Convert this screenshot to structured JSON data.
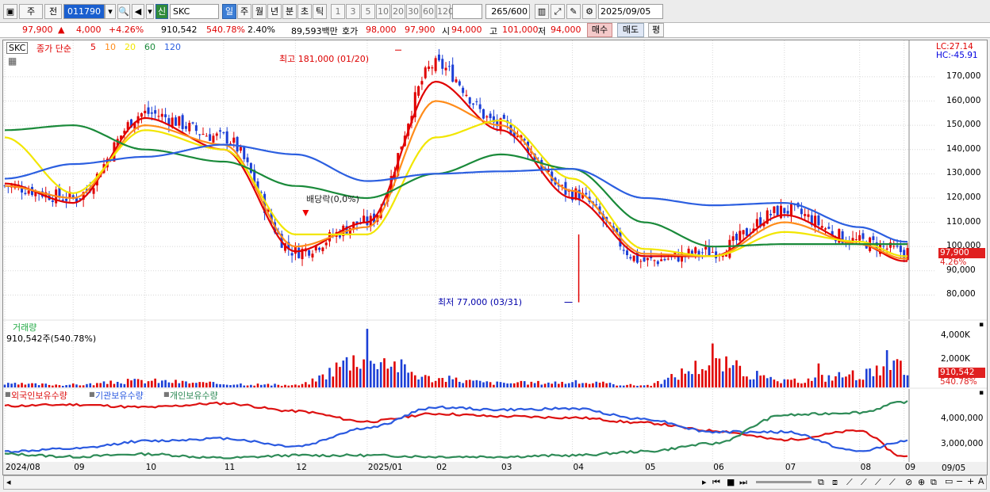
{
  "toolbar": {
    "mode_button": "주",
    "prev_button": "전",
    "code_value": "011790",
    "name_value": "SKC",
    "new_badge": "신",
    "periods": [
      "일",
      "주",
      "월",
      "년",
      "분",
      "초",
      "틱"
    ],
    "minutes": [
      "1",
      "3",
      "5",
      "10",
      "20",
      "30",
      "60",
      "120"
    ],
    "count_value": "265",
    "count_max": "/600",
    "date_value": "2025/09/05"
  },
  "quote": {
    "price": "97,900",
    "arrow": "▲",
    "change": "4,000",
    "rate": "+4.26%",
    "volume": "910,542",
    "vol_rate": "540.78%",
    "turnover": "2.40%",
    "amount": "89,593백만",
    "quote_label": "호가",
    "quote_price": "98,000",
    "quote_price2": "97,900",
    "open_label": "시",
    "open": "94,000",
    "high_label": "고",
    "high": "101,000",
    "low_label": "저",
    "low": "94,000",
    "buy_button": "매수",
    "sell_button": "매도",
    "avg_button": "평"
  },
  "legend": {
    "stock": "SKC",
    "title": "종가 단순",
    "ma": [
      {
        "label": "5",
        "color": "#e00000"
      },
      {
        "label": "10",
        "color": "#ff8c1a"
      },
      {
        "label": "20",
        "color": "#f2e600"
      },
      {
        "label": "60",
        "color": "#1a8a3a"
      },
      {
        "label": "120",
        "color": "#2c5fe0"
      }
    ]
  },
  "annotations": {
    "high_label": "최고 181,000 (01/20)",
    "low_label": "최저 77,000 (03/31)",
    "dividend_label": "배당락(0,0%)"
  },
  "price_axis": {
    "lc": "LC:27.14",
    "hc": "HC:-45.91",
    "ticks": [
      "170,000",
      "160,000",
      "150,000",
      "140,000",
      "130,000",
      "120,000",
      "110,000",
      "100,000",
      "90,000",
      "80,000"
    ],
    "tag_price": "97,900",
    "tag_rate": "4.26%"
  },
  "volume_panel": {
    "title": "거래량",
    "value": "910,542주(540.78%)",
    "ticks": [
      "4,000K",
      "2,000K"
    ],
    "tag_value": "910,542",
    "tag_rate": "540.78%"
  },
  "holding_panel": {
    "legends": [
      {
        "label": "외국인보유수량",
        "color": "#d11"
      },
      {
        "label": "기관보유수량",
        "color": "#2a59e0"
      },
      {
        "label": "개인보유수량",
        "color": "#2e8b57"
      }
    ],
    "ticks": [
      "4,000,000",
      "3,000,000"
    ]
  },
  "time_axis": {
    "labels": [
      "2024/08",
      "09",
      "10",
      "11",
      "12",
      "2025/01",
      "02",
      "03",
      "04",
      "05",
      "06",
      "07",
      "08",
      "09"
    ],
    "last_date": "09/05"
  },
  "chart_data": [
    {
      "type": "candlestick",
      "title": "종가 단순",
      "ylim": [
        70000,
        185000
      ],
      "x": [
        "2024/08",
        "09",
        "10",
        "11",
        "12",
        "2025/01",
        "02",
        "03",
        "04",
        "05",
        "06",
        "07",
        "08",
        "09"
      ],
      "close_approx": [
        125000,
        120000,
        155000,
        145000,
        98000,
        110000,
        175000,
        150000,
        122000,
        94000,
        98000,
        115000,
        102000,
        97900
      ],
      "series": [
        {
          "name": "5",
          "values": [
            126000,
            118000,
            153000,
            140000,
            98000,
            110000,
            168000,
            148000,
            120000,
            96000,
            96000,
            113000,
            101000,
            94000
          ]
        },
        {
          "name": "10",
          "values": [
            125000,
            120000,
            150000,
            142000,
            100000,
            108000,
            160000,
            150000,
            123000,
            97000,
            96000,
            110000,
            101000,
            95000
          ]
        },
        {
          "name": "20",
          "values": [
            145000,
            122000,
            148000,
            140000,
            105000,
            105000,
            145000,
            152000,
            128000,
            99000,
            96000,
            106000,
            102000,
            96000
          ]
        },
        {
          "name": "60",
          "values": [
            148000,
            150000,
            140000,
            135000,
            125000,
            120000,
            130000,
            138000,
            132000,
            110000,
            100000,
            101000,
            101000,
            101000
          ]
        },
        {
          "name": "120",
          "values": [
            128000,
            134000,
            137000,
            142000,
            138000,
            127000,
            130000,
            131000,
            132000,
            120000,
            117000,
            118000,
            108000,
            102000
          ]
        }
      ]
    },
    {
      "type": "bar",
      "title": "거래량",
      "ylim": [
        0,
        5000
      ],
      "categories": [
        "2024/08",
        "09",
        "10",
        "11",
        "12",
        "2025/01",
        "02",
        "03",
        "04",
        "05",
        "06",
        "07",
        "08",
        "09"
      ],
      "values": [
        450,
        380,
        900,
        520,
        300,
        4400,
        1200,
        600,
        700,
        300,
        3300,
        800,
        1800,
        2800
      ]
    },
    {
      "type": "line",
      "ylim": [
        2400000,
        5200000
      ],
      "x": [
        "2024/08",
        "09",
        "10",
        "11",
        "12",
        "2025/01",
        "02",
        "03",
        "04",
        "05",
        "06",
        "07",
        "08",
        "09"
      ],
      "series": [
        {
          "name": "외국인보유수량",
          "values": [
            4550000,
            4600000,
            4500000,
            4650000,
            4350000,
            3950000,
            4250000,
            4150000,
            4100000,
            3900000,
            3600000,
            3250000,
            3600000,
            2600000
          ]
        },
        {
          "name": "기관보유수량",
          "values": [
            2800000,
            2900000,
            3200000,
            3300000,
            3000000,
            3700000,
            4500000,
            4400000,
            4450000,
            4050000,
            3550000,
            3550000,
            2800000,
            3200000
          ]
        },
        {
          "name": "개인보유수량",
          "values": [
            2700000,
            2600000,
            2700000,
            2550000,
            2650000,
            2650000,
            2600000,
            2600000,
            2650000,
            2800000,
            3100000,
            4200000,
            4300000,
            4700000
          ]
        }
      ]
    }
  ]
}
